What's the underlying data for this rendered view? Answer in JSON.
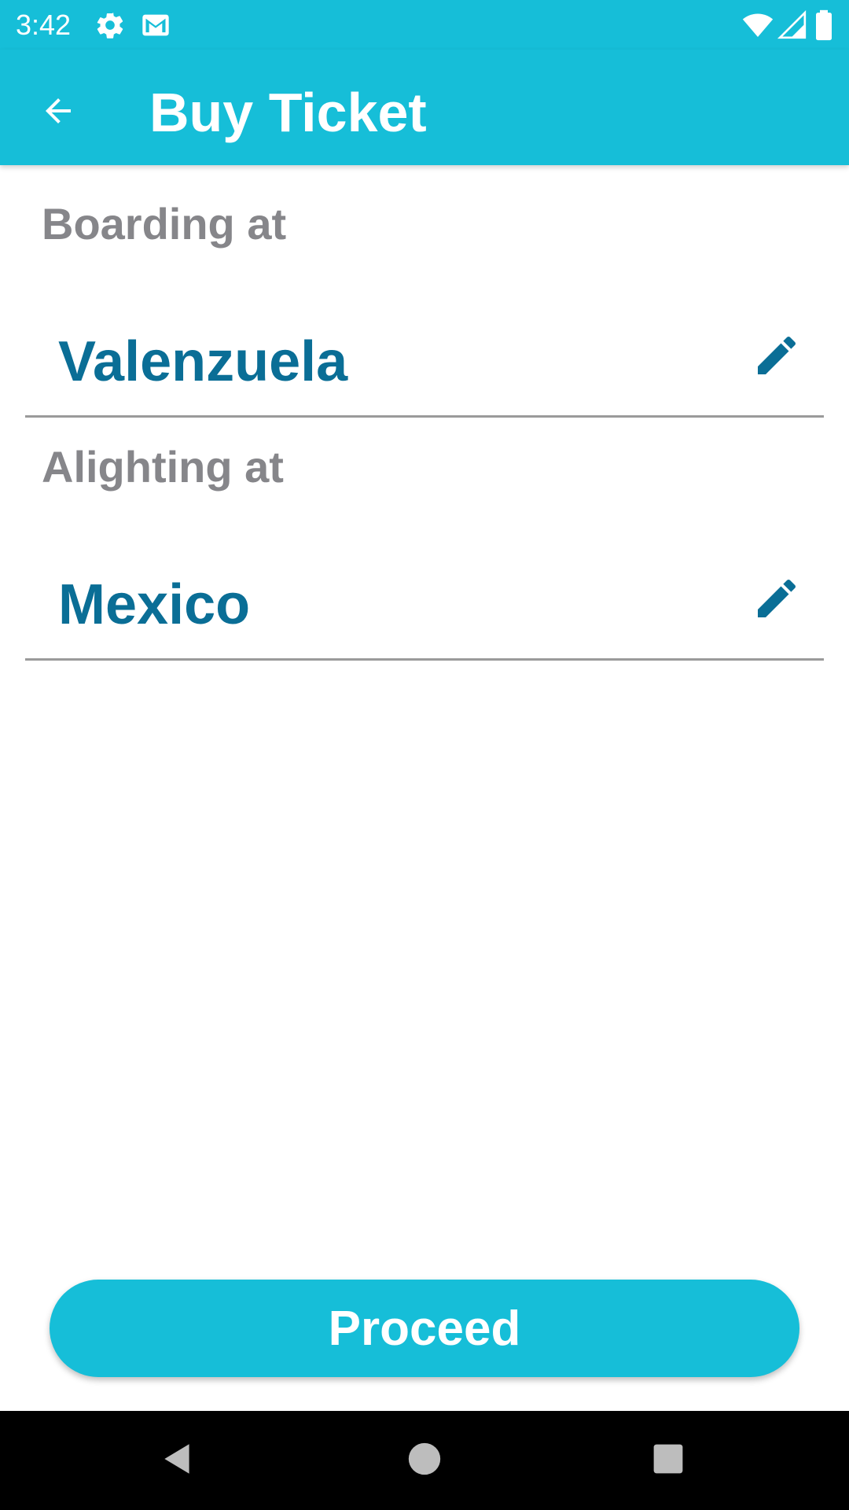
{
  "status_bar": {
    "time": "3:42",
    "icons_left": [
      "settings-icon",
      "gmail-icon"
    ],
    "icons_right": [
      "wifi-icon",
      "signal-icon",
      "battery-icon"
    ]
  },
  "app_bar": {
    "title": "Buy Ticket",
    "back_icon": "arrow-back-icon"
  },
  "boarding": {
    "label": "Boarding at",
    "value": "Valenzuela",
    "edit_icon": "pencil-icon"
  },
  "alighting": {
    "label": "Alighting at",
    "value": "Mexico",
    "edit_icon": "pencil-icon"
  },
  "proceed_button": {
    "label": "Proceed"
  },
  "nav_bar": {
    "buttons": [
      "back-triangle-icon",
      "home-circle-icon",
      "recents-square-icon"
    ]
  },
  "colors": {
    "primary": "#16BED8",
    "value_text": "#0A6E96",
    "label_text": "#86868A",
    "divider": "#9A9A9A"
  }
}
